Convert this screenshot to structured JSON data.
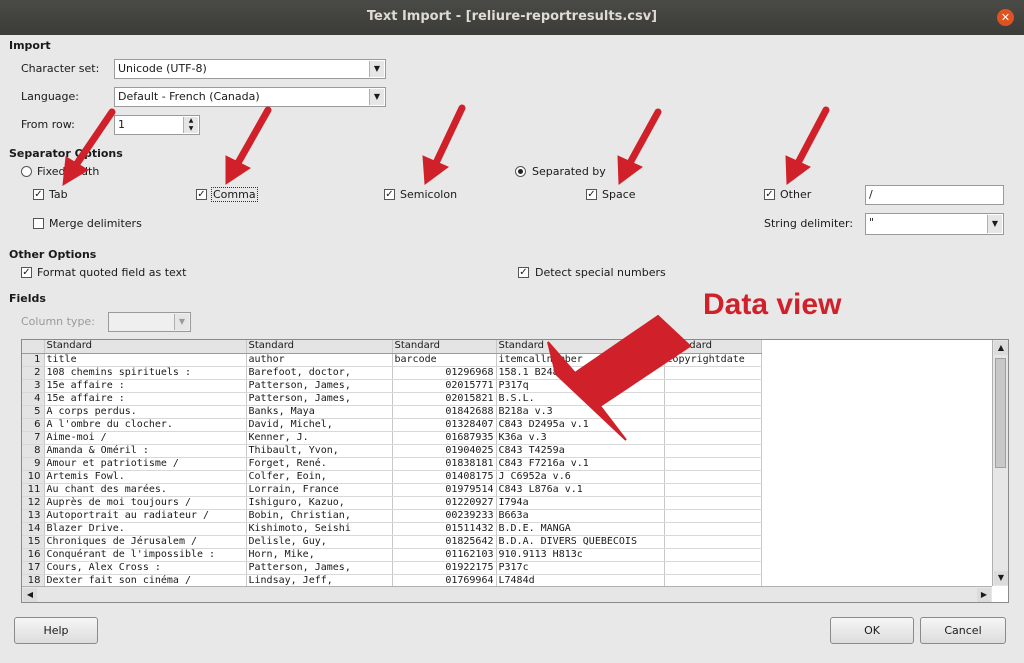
{
  "window": {
    "title": "Text Import - [reliure-reportresults.csv]"
  },
  "import": {
    "section": "Import",
    "charset_label": "Character set:",
    "charset_value": "Unicode (UTF-8)",
    "language_label": "Language:",
    "language_value": "Default - French (Canada)",
    "from_row_label": "From row:",
    "from_row_value": "1"
  },
  "separator": {
    "section": "Separator Options",
    "fixed_width": "Fixed width",
    "separated_by": "Separated by",
    "tab": "Tab",
    "comma": "Comma",
    "semicolon": "Semicolon",
    "space": "Space",
    "other": "Other",
    "other_value": "/",
    "merge": "Merge delimiters",
    "string_delim_label": "String delimiter:",
    "string_delim_value": "\""
  },
  "other_options": {
    "section": "Other Options",
    "format_quoted": "Format quoted field as text",
    "detect_special": "Detect special numbers"
  },
  "fields": {
    "section": "Fields",
    "column_type_label": "Column type:",
    "column_type_value": ""
  },
  "grid": {
    "headers": [
      "Standard",
      "Standard",
      "Standard",
      "Standard",
      "Standard"
    ],
    "rows": [
      [
        "1",
        "title",
        "author",
        "barcode",
        "itemcallnumber",
        "copyrightdate"
      ],
      [
        "2",
        "108 chemins spirituels :",
        "Barefoot, doctor,",
        "01296968",
        "158.1 B248c",
        ""
      ],
      [
        "3",
        "15e affaire :",
        "Patterson, James,",
        "02015771",
        "P317q",
        ""
      ],
      [
        "4",
        "15e affaire :",
        "Patterson, James,",
        "02015821",
        "B.S.L.",
        ""
      ],
      [
        "5",
        "A corps perdus.",
        "Banks, Maya",
        "01842688",
        "B218a v.3",
        ""
      ],
      [
        "6",
        "A l'ombre du clocher.",
        "David, Michel,",
        "01328407",
        "C843 D2495a v.1",
        ""
      ],
      [
        "7",
        "Aime-moi /",
        "Kenner, J.",
        "01687935",
        "K36a v.3",
        ""
      ],
      [
        "8",
        "Amanda & Oméril :",
        "Thibault, Yvon,",
        "01904025",
        "C843 T4259a",
        ""
      ],
      [
        "9",
        "Amour et patriotisme /",
        "Forget, René.",
        "01838181",
        "C843 F7216a v.1",
        ""
      ],
      [
        "10",
        "Artemis Fowl.",
        "Colfer, Eoin,",
        "01408175",
        "J C6952a v.6",
        ""
      ],
      [
        "11",
        "Au chant des marées.",
        "Lorrain, France",
        "01979514",
        "C843 L876a v.1",
        ""
      ],
      [
        "12",
        "Auprès de moi toujours /",
        "Ishiguro, Kazuo,",
        "01220927",
        "I794a",
        ""
      ],
      [
        "13",
        "Autoportrait au radiateur /",
        "Bobin, Christian,",
        "00239233",
        "B663a",
        ""
      ],
      [
        "14",
        "Blazer Drive.",
        "Kishimoto, Seishi",
        "01511432",
        "B.D.E. MANGA",
        ""
      ],
      [
        "15",
        "Chroniques de Jérusalem /",
        "Delisle, Guy,",
        "01825642",
        "B.D.A. DIVERS QUÉBÉCOIS",
        ""
      ],
      [
        "16",
        "Conquérant de l'impossible :",
        "Horn, Mike,",
        "01162103",
        "910.9113 H813c",
        ""
      ],
      [
        "17",
        "Cours, Alex Cross :",
        "Patterson, James,",
        "01922175",
        "P317c",
        ""
      ],
      [
        "18",
        "Dexter fait son cinéma /",
        "Lindsay, Jeff,",
        "01769964",
        "L7484d",
        ""
      ]
    ]
  },
  "annotation": {
    "label": "Data view"
  },
  "buttons": {
    "help": "Help",
    "ok": "OK",
    "cancel": "Cancel"
  },
  "colors": {
    "arrow": "#d0202a"
  }
}
